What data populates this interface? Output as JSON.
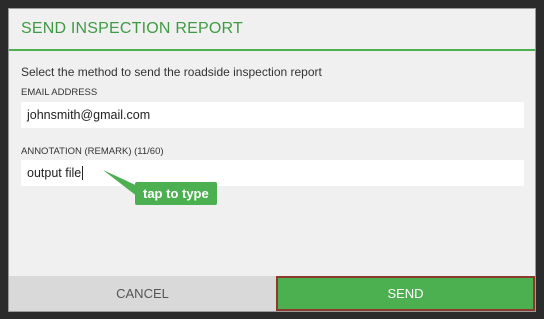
{
  "dialog": {
    "title": "SEND INSPECTION REPORT",
    "instructions": "Select the method to send the roadside inspection report",
    "email_label": "EMAIL ADDRESS",
    "email_value": "johnsmith@gmail.com",
    "annotation_label": "ANNOTATION (REMARK) (11/60)",
    "annotation_value": "output file",
    "tooltip": "tap to type",
    "cancel_label": "CANCEL",
    "send_label": "SEND"
  },
  "colors": {
    "accent": "#4caf50",
    "title": "#3f9b43",
    "send_border": "#8a3b2b"
  }
}
